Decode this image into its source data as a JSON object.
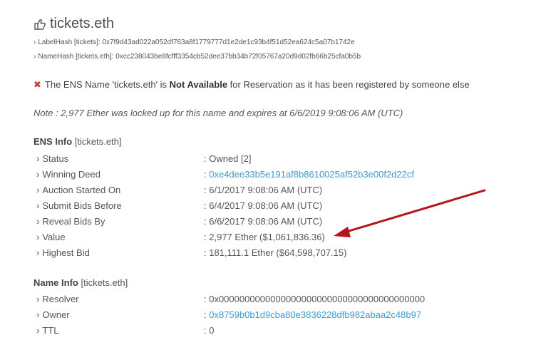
{
  "header": {
    "title": "tickets.eth",
    "label_hash": "LabelHash [tickets]: 0x7f9d43ad022a052df763a8f1779777d1e2de1c93b4f51d52ea624c5a07b1742e",
    "name_hash": "NameHash [tickets.eth]: 0xcc238043be8fcfff3354cb52dee37bb34b72f05767a20d9d02fb66b25cfa0b5b"
  },
  "availability": {
    "prefix": "The ENS Name 'tickets.eth' is ",
    "status": "Not Available",
    "suffix": " for Reservation as it has been registered by someone else"
  },
  "note": "Note : 2,977 Ether was locked up for this name and expires at 6/6/2019 9:08:06 AM (UTC)",
  "ens_info": {
    "title": "ENS Info",
    "name": "[tickets.eth]",
    "rows": [
      {
        "key": "Status",
        "value": ": Owned [2]"
      },
      {
        "key": "Winning Deed",
        "sep": ": ",
        "value": "0xe4dee33b5e191af8b8610025af52b3e00f2d22cf"
      },
      {
        "key": "Auction Started On",
        "value": ": 6/1/2017 9:08:06 AM (UTC)"
      },
      {
        "key": "Submit Bids Before",
        "value": ": 6/4/2017 9:08:06 AM (UTC)"
      },
      {
        "key": "Reveal Bids By",
        "value": ": 6/6/2017 9:08:06 AM (UTC)"
      },
      {
        "key": "Value",
        "value": ": 2,977 Ether ($1,061,836.36)"
      },
      {
        "key": "Highest Bid",
        "value": ": 181,111.1 Ether ($64,598,707.15)"
      }
    ]
  },
  "name_info": {
    "title": "Name Info",
    "name": "[tickets.eth]",
    "rows": [
      {
        "key": "Resolver",
        "value": ": 0x0000000000000000000000000000000000000000"
      },
      {
        "key": "Owner",
        "sep": ": ",
        "value": "0x8759b0b1d9cba80e3836228dfb982abaa2c48b97"
      },
      {
        "key": "TTL",
        "value": ": 0"
      }
    ]
  },
  "chevron": "›",
  "icons": {
    "title": "hand-point-right-icon",
    "status": "x-icon",
    "chevron": "chevron-right-icon"
  },
  "colors": {
    "link": "#3b9bd1",
    "error": "#c0392b",
    "arrow": "#b5141c"
  }
}
